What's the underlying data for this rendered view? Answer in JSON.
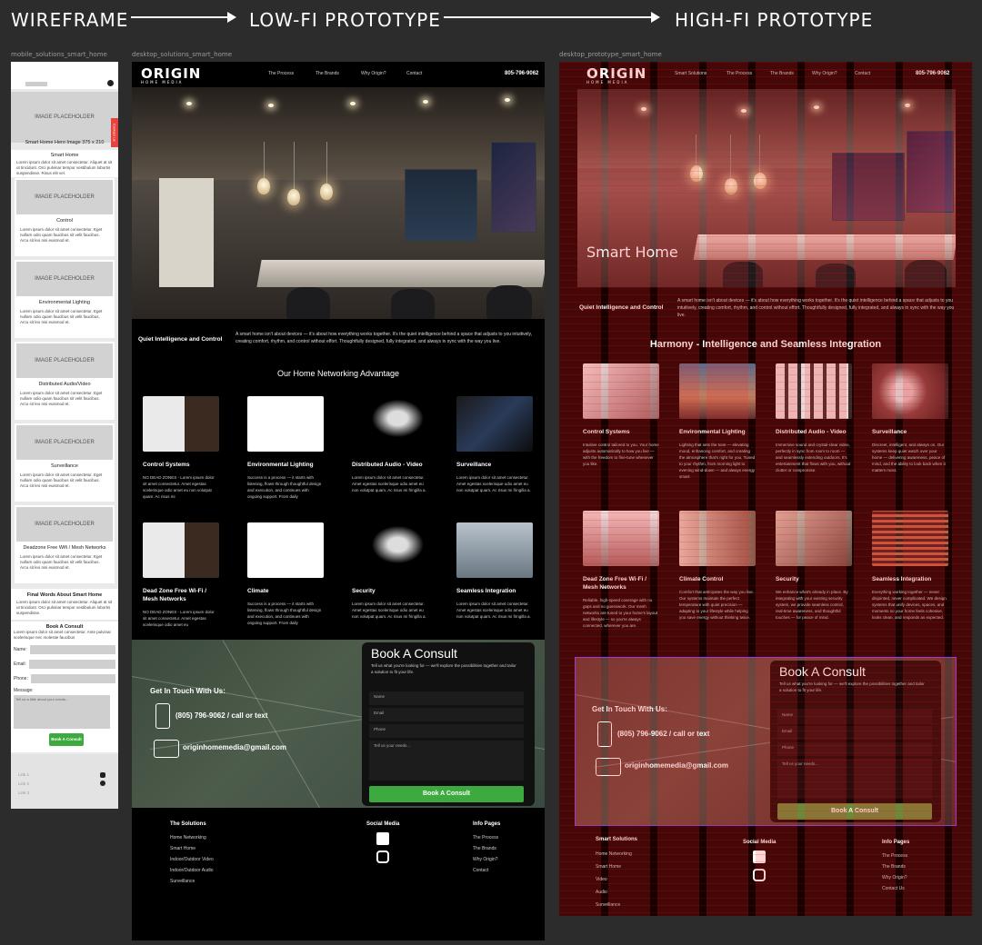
{
  "stages": {
    "wireframe": "WIREFRAME",
    "lowfi": "LOW-FI PROTOTYPE",
    "hifi": "HIGH-FI PROTOTYPE"
  },
  "frame_labels": {
    "mobile": "mobile_solutions_smart_home",
    "desktop": "desktop_solutions_smart_home",
    "prototype": "desktop_prototype_smart_home"
  },
  "wireframe": {
    "hero_placeholder": "IMAGE PLACEHOLDER",
    "hero_caption": "Smart Home Hero Image 375 x 210",
    "side_tab": "Contact Us",
    "intro_title": "Smart Home",
    "intro_text": "Lorem ipsum dolor sit amet consectetur. Aliquet at sit ut tincidunt. Orci pulvinar tempor vestibulum lobortis suspendisse. Risus elit vel.",
    "cards": [
      {
        "placeholder": "IMAGE PLACEHOLDER",
        "title": "Control",
        "text": "Lorem ipsum dolor sit amet consectetur. Eget nullam odio quam faucibus sit velit faucibus. Arcu sit leo nisi euismod et."
      },
      {
        "placeholder": "IMAGE PLACEHOLDER",
        "title": "Environmental Lighting",
        "text": "Lorem ipsum dolor sit amet consectetur. Eget nullam odio quam faucibus sit velit faucibus. Arcu sit leo nisi euismod et."
      },
      {
        "placeholder": "IMAGE PLACEHOLDER",
        "title": "Distributed Audio/Video",
        "text": "Lorem ipsum dolor sit amet consectetur. Eget nullam odio quam faucibus sit velit faucibus. Arcu sit leo nisi euismod et."
      },
      {
        "placeholder": "IMAGE PLACEHOLDER",
        "title": "Surveillance",
        "text": "Lorem ipsum dolor sit amet consectetur. Eget nullam odio quam faucibus sit velit faucibus. Arcu sit leo nisi euismod et."
      },
      {
        "placeholder": "IMAGE PLACEHOLDER",
        "title": "Deadzone Free Wifi / Mesh Networks",
        "text": "Lorem ipsum dolor sit amet consectetur. Eget nullam odio quam faucibus sit velit faucibus. Arcu sit leo nisi euismod et."
      }
    ],
    "final_title": "Final Words About Smart Home",
    "final_text": "Lorem ipsum dolor sit amet consectetur. Aliquet at sit ut tincidunt. Orci pulvinar tempor vestibulum lobortis suspendisse.",
    "consult_title": "Book A Consult",
    "consult_text": "Lorem ipsum dolor sit amet consectetur. Ante pulvinar scelerisque nec molestie faucibus",
    "fields": [
      "Name:",
      "Email:",
      "Phone:"
    ],
    "message_label": "Message:",
    "message_placeholder": "Tell us a little about your needs...",
    "button": "Book A Consult",
    "links": [
      "Link 1",
      "Link 2",
      "Link 3"
    ]
  },
  "lowfi": {
    "logo": "ORIGIN",
    "logo_sub": "HOME MEDIA",
    "nav": [
      "The Process",
      "The Brands",
      "Why Origin?",
      "Contact"
    ],
    "phone": "805-796-9062",
    "intro_label": "Quiet Intelligence and Control",
    "intro_text": "A smart home isn't about devices — it's about how everything works together. It's the quiet intelligence behind a space that adjusts to you intuitively, creating comfort, rhythm, and control without effort. Thoughtfully designed, fully integrated, and always in sync with the way you live.",
    "section_title": "Our Home Networking Advantage",
    "tiles": [
      {
        "title": "Control Systems",
        "text": "NO DEAD ZONES - Lorem ipsum dolor sit amet consectetur. Amet egestas scelerisque odio amet eu non volutpat quam. Ac risus mi"
      },
      {
        "title": "Environmental Lighting",
        "text": "Success is a process — it starts with listening, flows through thoughtful design and execution, and continues with ongoing support. From daily"
      },
      {
        "title": "Distributed Audio - Video",
        "text": "Lorem ipsum dolor sit amet consectetur. Amet egestas scelerisque odio amet eu non volutpat quam. Ac risus mi fringilla a."
      },
      {
        "title": "Surveillance",
        "text": "Lorem ipsum dolor sit amet consectetur. Amet egestas scelerisque odio amet eu non volutpat quam. Ac risus mi fringilla a."
      },
      {
        "title": "Dead Zone Free Wi-Fi / Mesh Networks",
        "text": "NO DEAD ZONES - Lorem ipsum dolor sit amet consectetur. Amet egestas scelerisque odio amet eu"
      },
      {
        "title": "Climate",
        "text": "Success is a process — it starts with listening, flows through thoughtful design and execution, and continues with ongoing support. From daily"
      },
      {
        "title": "Security",
        "text": "Lorem ipsum dolor sit amet consectetur. Amet egestas scelerisque odio amet eu non volutpat quam. Ac risus mi fringilla a."
      },
      {
        "title": "Seamless Integration",
        "text": "Lorem ipsum dolor sit amet consectetur. Amet egestas scelerisque odio amet eu non volutpat quam. Ac risus mi fringilla a."
      }
    ],
    "contact_heading": "Get In Touch With Us:",
    "contact_phone": "(805) 796-9062  /  call or text",
    "contact_email": "originhomemedia@gmail.com",
    "consult_title": "Book A Consult",
    "consult_text": "Tell us what you're looking for — we'll explore the possibilities together and tailor a solution to fit your life.",
    "fields": [
      "Name",
      "Email",
      "Phone",
      "Tell us your needs..."
    ],
    "button": "Book A Consult",
    "footer": {
      "solutions_h": "The Solutions",
      "solutions": [
        "Home Networking",
        "Smart Home",
        "Indoor/Outdoor Video",
        "Indoor/Outdoor Audio",
        "Surveillance"
      ],
      "social_h": "Social Media",
      "info_h": "Info Pages",
      "info": [
        "The Process",
        "The Brands",
        "Why Origin?",
        "Contact"
      ]
    }
  },
  "hifi": {
    "logo": "ORIGIN",
    "logo_sub": "HOME MEDIA",
    "nav": [
      "Smart Solutions",
      "The Process",
      "The Brands",
      "Why Origin?",
      "Contact"
    ],
    "phone": "805-796-9062",
    "hero_title": "Smart Home",
    "intro_label": "Quiet Intelligence and Control",
    "intro_text": "A smart home isn't about devices — it's about how everything works together. It's the quiet intelligence behind a space that adjusts to you intuitively, creating comfort, rhythm, and control without effort. Thoughtfully designed, fully integrated, and always in sync with the way you live.",
    "section_title": "Harmony - Intelligence and Seamless Integration",
    "tiles": [
      {
        "title": "Control Systems",
        "text": "Intuitive control tailored to you. Your home adjusts automatically to how you live — with the freedom to fine-tune whenever you like."
      },
      {
        "title": "Environmental Lighting",
        "text": "Lighting that sets the tone — elevating mood, enhancing comfort, and creating the atmosphere that's right for you. Tuned to your rhythm, from morning light to evening wind-down — and always energy smart."
      },
      {
        "title": "Distributed Audio - Video",
        "text": "Immersive sound and crystal-clear video, perfectly in sync from room to room — and seamlessly extending outdoors. It's entertainment that flows with you, without clutter or compromise."
      },
      {
        "title": "Surveillance",
        "text": "Discreet, intelligent, and always on. Our systems keep quiet watch over your home — delivering awareness, peace of mind, and the ability to look back when it matters most."
      },
      {
        "title": "Dead Zone Free Wi-Fi / Mesh Networks",
        "text": "Reliable, high-speed coverage with no gaps and no guesswork. Our mesh networks are tuned to your home's layout and lifestyle — so you're always connected, wherever you are."
      },
      {
        "title": "Climate Control",
        "text": "Comfort that anticipates the way you live. Our systems maintain the perfect temperature with quiet precision — adapting to your lifestyle while helping you save energy without thinking twice."
      },
      {
        "title": "Security",
        "text": "We enhance what's already in place. By integrating with your existing security system, we provide seamless control, real-time awareness, and thoughtful touches — for peace of mind."
      },
      {
        "title": "Seamless Integration",
        "text": "Everything working together — never disjointed, never complicated. We design systems that unify devices, spaces, and moments so your home feels cohesive, looks clean, and responds as expected."
      }
    ],
    "contact_heading": "Get In Touch With Us:",
    "contact_phone": "(805) 796-9062  /  call or text",
    "contact_email": "originhomemedia@gmail.com",
    "consult_title": "Book A Consult",
    "consult_text": "Tell us what you're looking for — we'll explore the possibilities together and tailor a solution to fit your life.",
    "fields": [
      "Name",
      "Email",
      "Phone",
      "Tell us your needs..."
    ],
    "button": "Book A Consult",
    "footer": {
      "solutions_h": "Smart Solutions",
      "solutions": [
        "Home Networking",
        "Smart Home",
        "Video",
        "Audio",
        "Surveillance"
      ],
      "social_h": "Social Media",
      "info_h": "Info Pages",
      "info": [
        "The Process",
        "The Brands",
        "Why Origin?",
        "Contact Us"
      ]
    }
  },
  "colors": {
    "background": "#2c2c2c",
    "accent_green": "#3daa3f",
    "hifi_overlay": "#ff2020",
    "selection_outline": "#8a3cff"
  }
}
